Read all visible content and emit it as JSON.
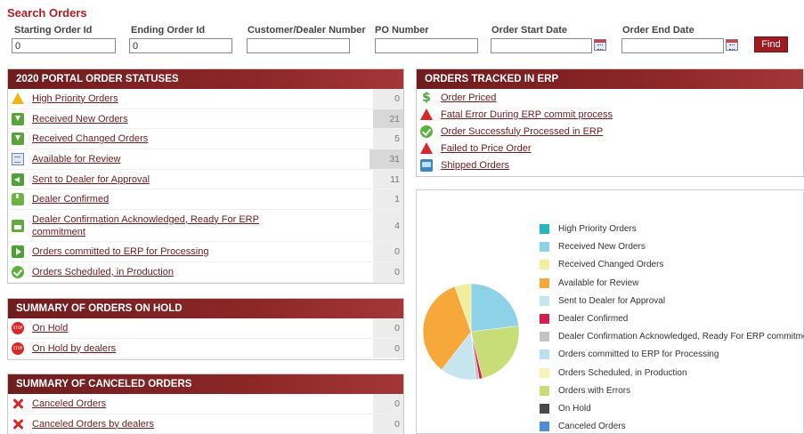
{
  "search": {
    "title": "Search Orders",
    "fields": [
      {
        "label": "Starting Order Id",
        "value": "0"
      },
      {
        "label": "Ending Order Id",
        "value": "0"
      },
      {
        "label": "Customer/Dealer Number",
        "value": ""
      },
      {
        "label": "PO Number",
        "value": ""
      },
      {
        "label": "Order Start Date",
        "value": ""
      },
      {
        "label": "Order End Date",
        "value": ""
      }
    ],
    "find_label": "Find"
  },
  "portal": {
    "title": "2020 PORTAL ORDER STATUSES",
    "rows": [
      {
        "label": "High Priority Orders",
        "count": "0",
        "icon": "warning-icon"
      },
      {
        "label": "Received New Orders",
        "count": "21",
        "icon": "download-icon"
      },
      {
        "label": "Received Changed Orders",
        "count": "5",
        "icon": "download-icon"
      },
      {
        "label": "Available for Review",
        "count": "31",
        "icon": "document-icon"
      },
      {
        "label": "Sent to Dealer for Approval",
        "count": "11",
        "icon": "send-icon"
      },
      {
        "label": "Dealer Confirmed",
        "count": "1",
        "icon": "thumbs-up-icon"
      },
      {
        "label": "Dealer Confirmation Acknowledged, Ready For ERP commitment",
        "count": "4",
        "icon": "erp-icon"
      },
      {
        "label": "Orders committed to ERP for Processing",
        "count": "0",
        "icon": "arrow-right-icon"
      },
      {
        "label": "Orders Scheduled, in Production",
        "count": "0",
        "icon": "check-circle-icon"
      }
    ]
  },
  "hold": {
    "title": "SUMMARY OF ORDERS ON HOLD",
    "rows": [
      {
        "label": "On Hold",
        "count": "0",
        "icon": "stop-icon"
      },
      {
        "label": "On Hold by dealers",
        "count": "0",
        "icon": "stop-icon"
      }
    ]
  },
  "canceled": {
    "title": "SUMMARY OF CANCELED ORDERS",
    "rows": [
      {
        "label": "Canceled Orders",
        "count": "0",
        "icon": "red-x-icon"
      },
      {
        "label": "Canceled Orders by dealers",
        "count": "0",
        "icon": "red-x-icon"
      }
    ]
  },
  "erp": {
    "title": "ORDERS TRACKED IN ERP",
    "rows": [
      {
        "label": "Order Priced",
        "icon": "dollar-icon"
      },
      {
        "label": "Fatal Error During ERP commit process",
        "icon": "error-triangle-icon"
      },
      {
        "label": "Order Successfuly Processed in ERP",
        "icon": "check-circle-icon"
      },
      {
        "label": "Failed to Price Order",
        "icon": "error-triangle-icon"
      },
      {
        "label": "Shipped Orders",
        "icon": "truck-icon"
      }
    ]
  },
  "chart_data": {
    "type": "pie",
    "title": "",
    "series": [
      {
        "name": "High Priority Orders",
        "value": 0,
        "color": "#22b6c0"
      },
      {
        "name": "Received New Orders",
        "value": 21,
        "color": "#8dd2e6"
      },
      {
        "name": "Received Changed Orders",
        "value": 5,
        "color": "#f2ee9e"
      },
      {
        "name": "Available for Review",
        "value": 31,
        "color": "#f7a83a"
      },
      {
        "name": "Sent to Dealer for Approval",
        "value": 11,
        "color": "#c6e6ef"
      },
      {
        "name": "Dealer Confirmed",
        "value": 1,
        "color": "#d61f4f"
      },
      {
        "name": "Dealer Confirmation Acknowledged, Ready For ERP commitment",
        "value": 4,
        "color": "#c3c3c3"
      },
      {
        "name": "Orders committed to ERP for Processing",
        "value": 0,
        "color": "#b9dff3"
      },
      {
        "name": "Orders Scheduled, in Production",
        "value": 0,
        "color": "#f7f4b6"
      },
      {
        "name": "Orders with Errors",
        "value": 0,
        "color": "#c8dc78"
      },
      {
        "name": "On Hold",
        "value": 0,
        "color": "#4a4a4a"
      },
      {
        "name": "Canceled Orders",
        "value": 0,
        "color": "#4c8fd2"
      }
    ],
    "slices_drawn": [
      {
        "name": "Received New Orders",
        "value": 21,
        "color": "#8dd2e6"
      },
      {
        "name": "Orders with Errors",
        "value": 21,
        "color": "#c8dc78"
      },
      {
        "name": "Dealer Confirmed",
        "value": 1,
        "color": "#d61f4f"
      },
      {
        "name": "Dealer Confirmation Acknowledged, Ready For ERP commitment",
        "value": 1,
        "color": "#c3c3c3"
      },
      {
        "name": "Sent to Dealer for Approval",
        "value": 11,
        "color": "#c6e6ef"
      },
      {
        "name": "Available for Review",
        "value": 31,
        "color": "#f7a83a"
      },
      {
        "name": "Received Changed Orders",
        "value": 5,
        "color": "#f2ee9e"
      }
    ],
    "legend_placement": "right"
  }
}
